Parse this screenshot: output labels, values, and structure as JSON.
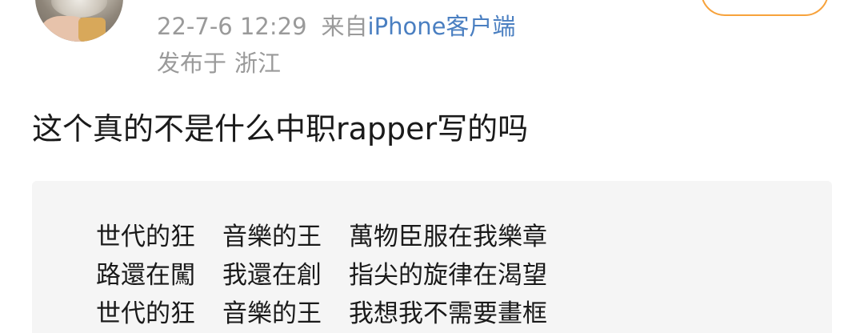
{
  "post": {
    "meta": {
      "timestamp": "22-7-6 12:29",
      "source_prefix": "来自",
      "client": "iPhone客户端"
    },
    "location": {
      "prefix": "发布于",
      "place": "浙江"
    },
    "text": "这个真的不是什么中职rapper写的吗",
    "quote": {
      "lines": [
        [
          "世代的狂",
          "音樂的王",
          "萬物臣服在我樂章"
        ],
        [
          "路還在闖",
          "我還在創",
          "指尖的旋律在渴望"
        ],
        [
          "世代的狂",
          "音樂的王",
          "我想我不需要畫框"
        ]
      ]
    }
  },
  "colors": {
    "meta_gray": "#9a9a9a",
    "link_blue": "#4a7fc1",
    "follow_orange": "#f7a23b",
    "card_bg": "#f5f5f5"
  }
}
